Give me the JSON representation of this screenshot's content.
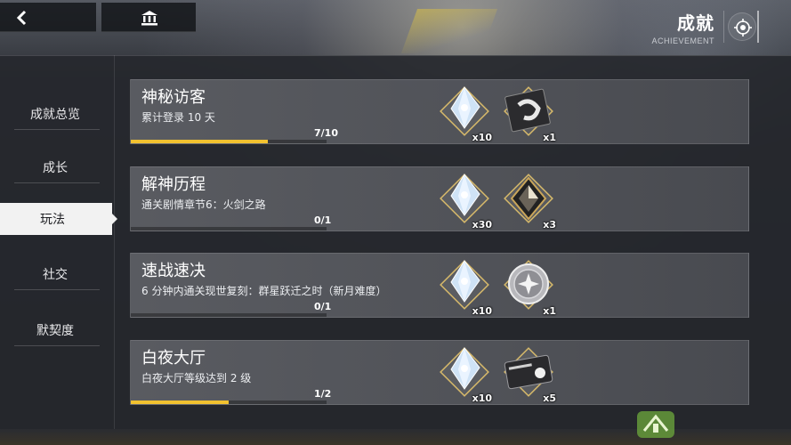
{
  "header": {
    "title": "成就",
    "subtitle": "ACHIEVEMENT",
    "back_icon": "chevron-left-icon",
    "home_icon": "bank-icon",
    "settings_icon": "target-icon"
  },
  "sidebar": {
    "items": [
      {
        "label": "成就总览",
        "active": false
      },
      {
        "label": "成长",
        "active": false
      },
      {
        "label": "玩法",
        "active": true
      },
      {
        "label": "社交",
        "active": false
      },
      {
        "label": "默契度",
        "active": false
      }
    ]
  },
  "achievements": [
    {
      "title": "神秘访客",
      "desc": "累计登录 10 天",
      "progress_text": "7/10",
      "progress": 0.7,
      "rewards": [
        {
          "icon": "crystal-icon",
          "qty": "x10"
        },
        {
          "icon": "ticket-icon",
          "qty": "x1"
        }
      ]
    },
    {
      "title": "解神历程",
      "desc": "通关剧情章节6：火剑之路",
      "progress_text": "0/1",
      "progress": 0,
      "rewards": [
        {
          "icon": "crystal-icon",
          "qty": "x30"
        },
        {
          "icon": "dark-cube-icon",
          "qty": "x3"
        }
      ]
    },
    {
      "title": "速战速决",
      "desc": "6 分钟内通关现世复刻：群星跃迁之时（新月难度）",
      "progress_text": "0/1",
      "progress": 0,
      "rewards": [
        {
          "icon": "crystal-icon",
          "qty": "x10"
        },
        {
          "icon": "silver-coin-icon",
          "qty": "x1"
        }
      ]
    },
    {
      "title": "白夜大厅",
      "desc": "白夜大厅等级达到 2 级",
      "progress_text": "1/2",
      "progress": 0.5,
      "rewards": [
        {
          "icon": "crystal-icon",
          "qty": "x10"
        },
        {
          "icon": "card-icon",
          "qty": "x5"
        }
      ]
    }
  ],
  "colors": {
    "progress": "#f2c230",
    "active_tab_bg": "#f2f2f2"
  }
}
